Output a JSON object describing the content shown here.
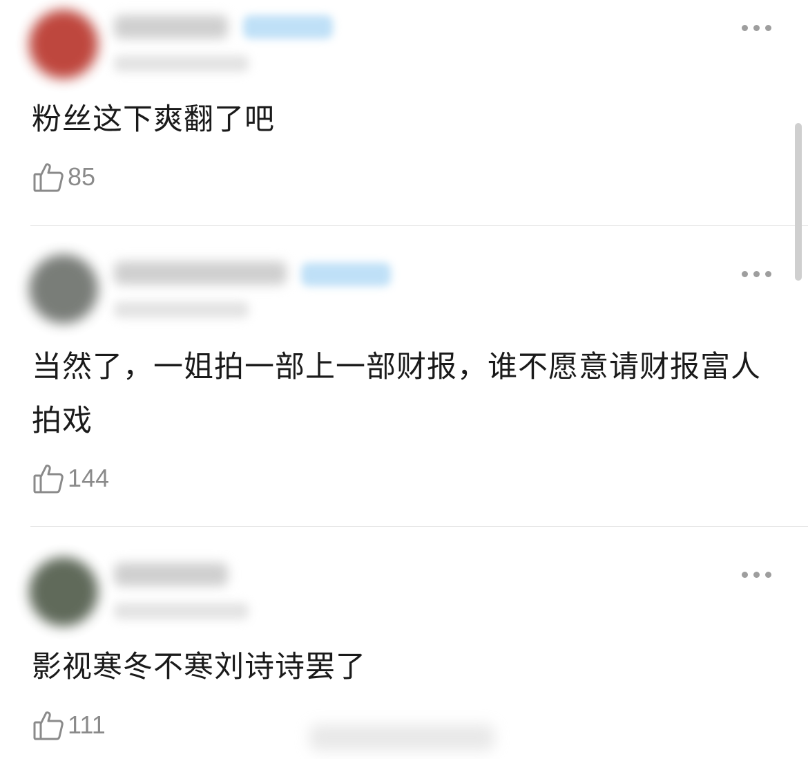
{
  "comments": [
    {
      "text": "粉丝这下爽翻了吧",
      "likes": "85",
      "avatar_color": "#b8342a",
      "has_badge": true
    },
    {
      "text": "当然了，一姐拍一部上一部财报，谁不愿意请财报富人拍戏",
      "likes": "144",
      "avatar_color": "#6b6f6a",
      "has_badge": true
    },
    {
      "text": "影视寒冬不寒刘诗诗罢了",
      "likes": "111",
      "avatar_color": "#4f5a49",
      "has_badge": false
    }
  ],
  "icons": {
    "like": "thumbs-up-icon",
    "more": "more-dots-icon"
  },
  "colors": {
    "text": "#1a1a1a",
    "count": "#8a8a8a",
    "divider": "#e4e4e4",
    "badge": "#bfe0f7"
  }
}
